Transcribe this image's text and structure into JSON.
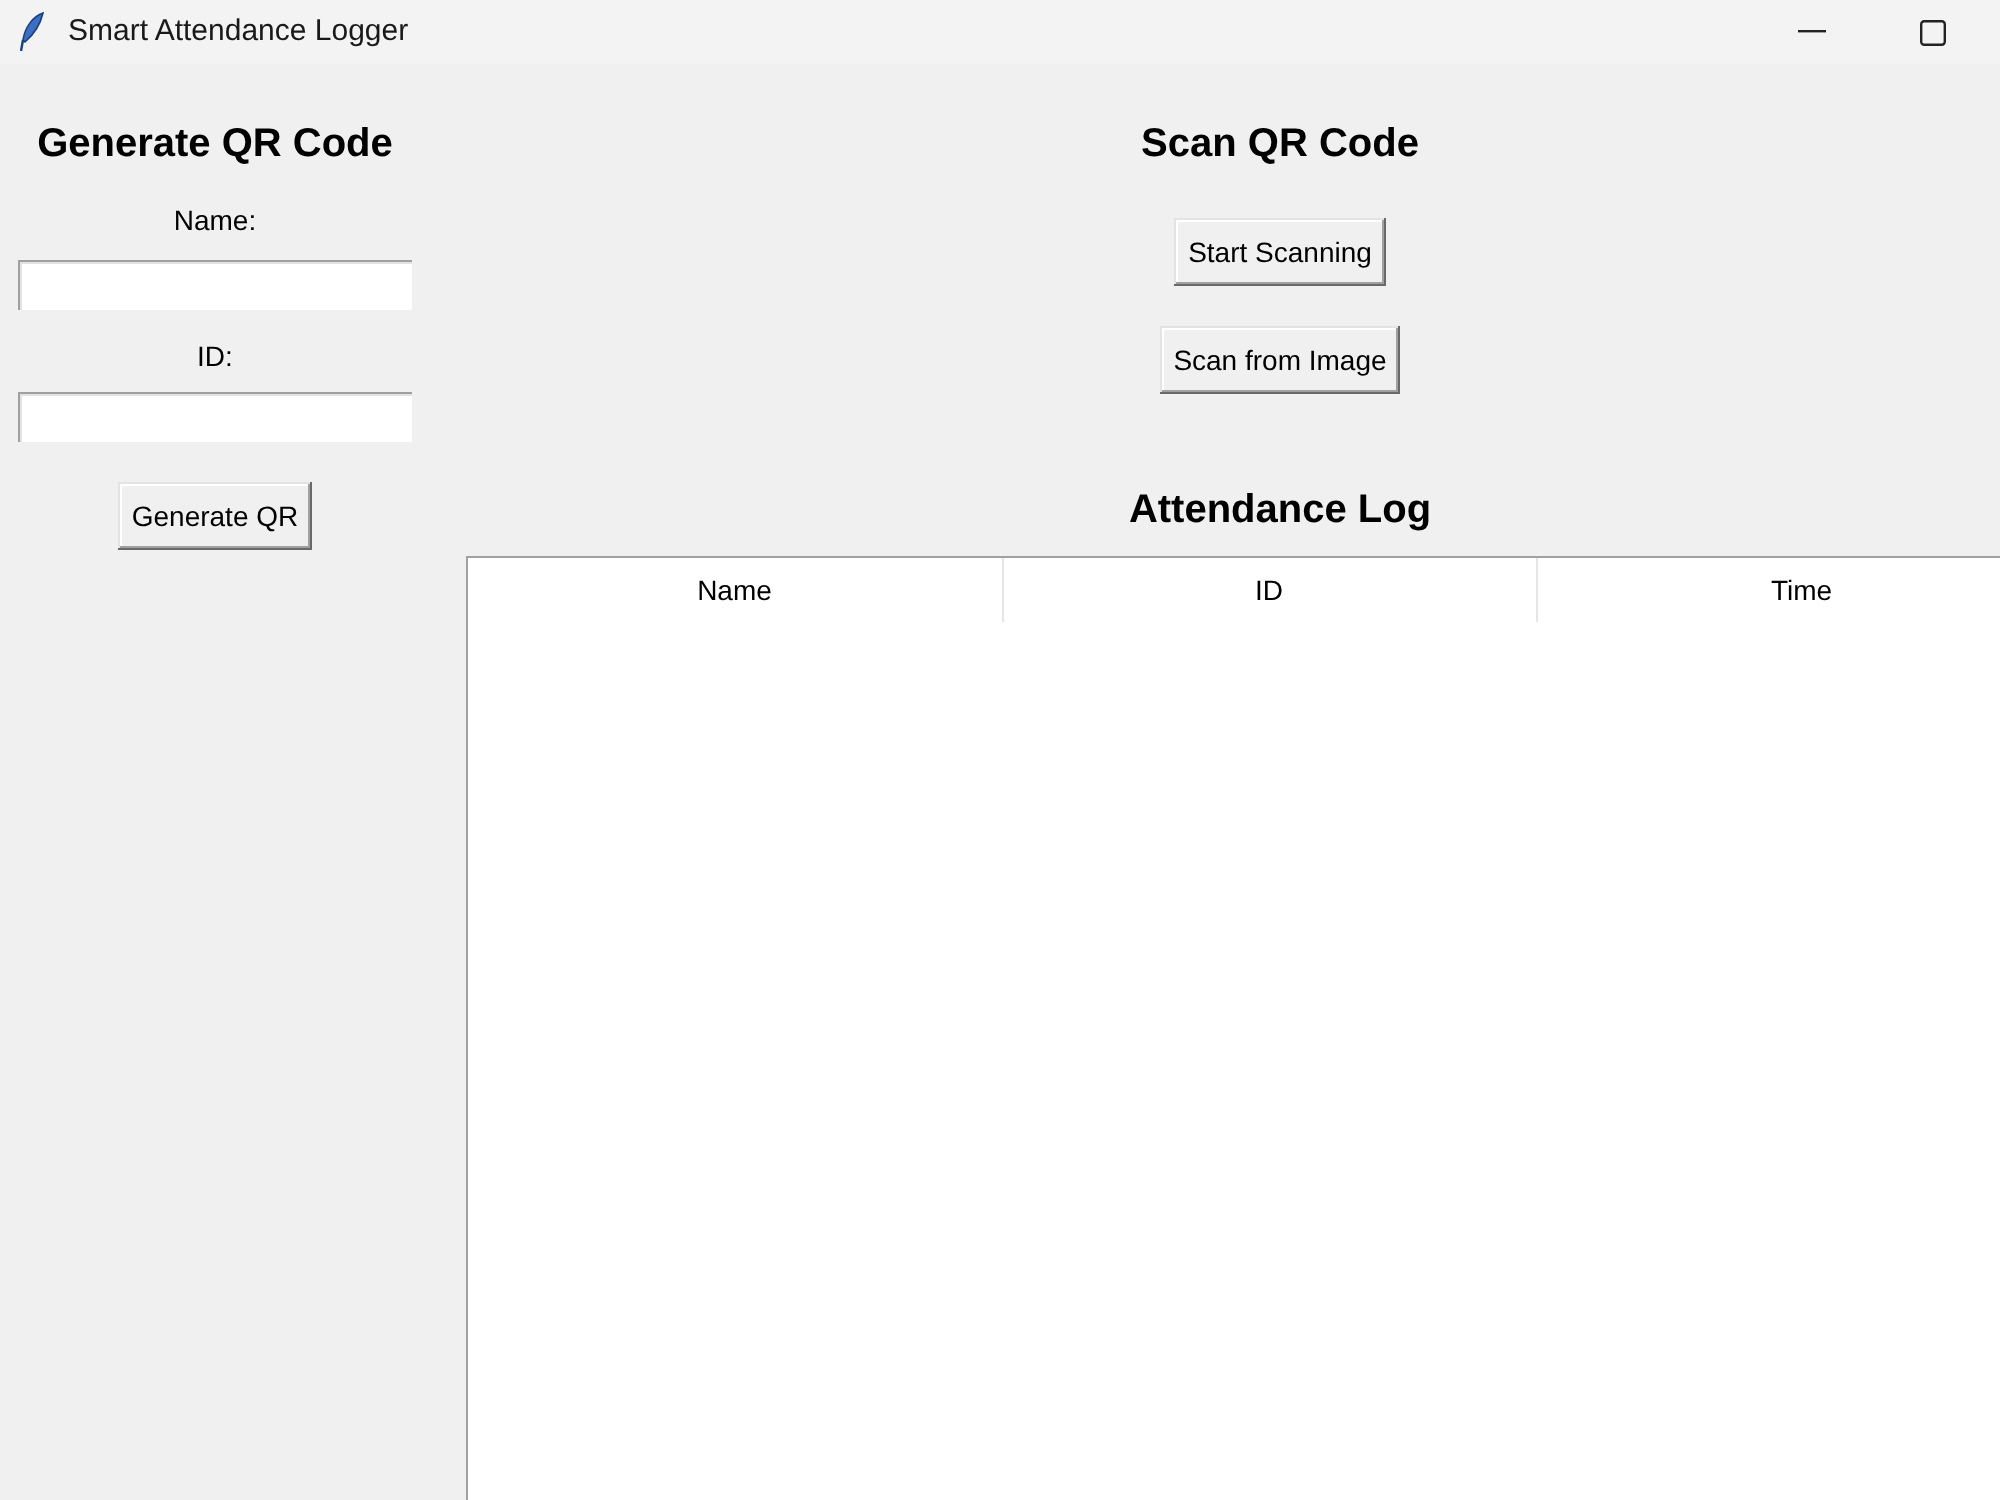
{
  "window": {
    "title": "Smart Attendance Logger"
  },
  "generate_panel": {
    "heading": "Generate QR Code",
    "fields": [
      {
        "label": "Name:"
      },
      {
        "label": "ID:"
      }
    ],
    "button": "Generate QR"
  },
  "scan_panel": {
    "heading": "Scan QR Code",
    "buttons": [
      "Start Scanning",
      "Scan from Image"
    ]
  },
  "attendance_log": {
    "heading": "Attendance Log",
    "table": {
      "columns": [
        "Name",
        "ID",
        "Time"
      ]
    }
  }
}
